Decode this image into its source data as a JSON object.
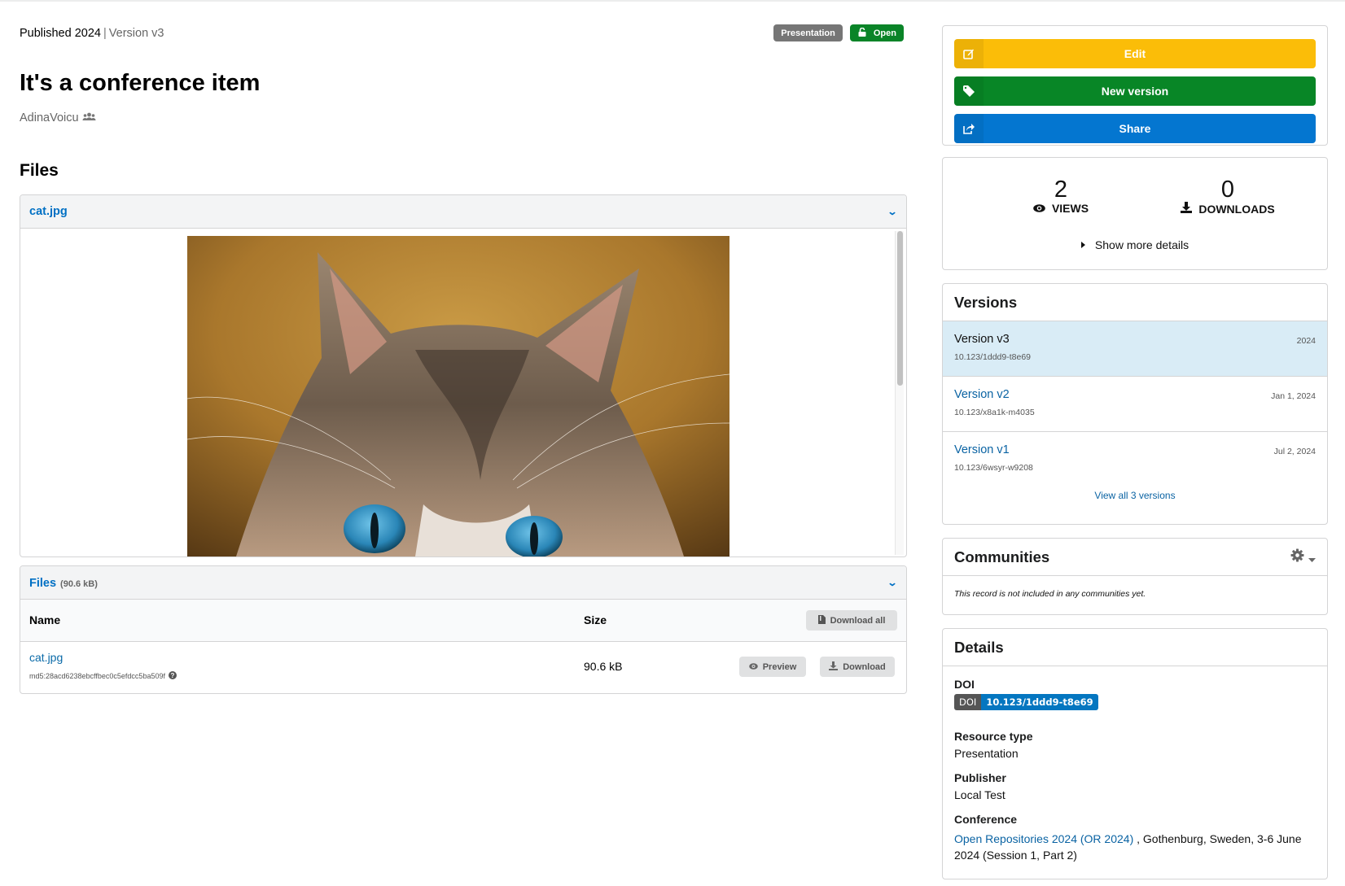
{
  "record": {
    "published": "Published 2024",
    "separator": "|",
    "version": "Version v3",
    "title": "It's a conference item",
    "author": "AdinaVoicu",
    "badges": {
      "resource_type": "Presentation",
      "access": "Open"
    }
  },
  "files_section": {
    "heading": "Files",
    "preview": {
      "filename": "cat.jpg"
    },
    "list": {
      "title": "Files",
      "total_size": "(90.6 kB)",
      "columns": {
        "name": "Name",
        "size": "Size"
      },
      "download_all_label": "Download all",
      "rows": [
        {
          "name": "cat.jpg",
          "checksum": "md5:28acd6238ebcffbec0c5efdcc5ba509f",
          "size": "90.6 kB",
          "preview_label": "Preview",
          "download_label": "Download"
        }
      ]
    }
  },
  "sidebar": {
    "actions": {
      "edit": "Edit",
      "new_version": "New version",
      "share": "Share"
    },
    "stats": {
      "views_count": "2",
      "views_label": "VIEWS",
      "downloads_count": "0",
      "downloads_label": "DOWNLOADS",
      "more_details": "Show more details"
    },
    "versions": {
      "title": "Versions",
      "items": [
        {
          "label": "Version v3",
          "doi": "10.123/1ddd9-t8e69",
          "date": "2024",
          "active": true
        },
        {
          "label": "Version v2",
          "doi": "10.123/x8a1k-m4035",
          "date": "Jan 1, 2024",
          "active": false
        },
        {
          "label": "Version v1",
          "doi": "10.123/6wsyr-w9208",
          "date": "Jul 2, 2024",
          "active": false
        }
      ],
      "view_all": "View all 3 versions"
    },
    "communities": {
      "title": "Communities",
      "empty_text": "This record is not included in any communities yet."
    },
    "details": {
      "title": "Details",
      "doi_label": "DOI",
      "doi_badge_prefix": "DOI",
      "doi_value": "10.123/1ddd9-t8e69",
      "resource_type_label": "Resource type",
      "resource_type": "Presentation",
      "publisher_label": "Publisher",
      "publisher": "Local Test",
      "conference_label": "Conference",
      "conference_link": "Open Repositories 2024 (OR 2024)",
      "conference_rest": " , Gothenburg, Sweden, 3-6 June 2024 (Session 1, Part 2)"
    }
  },
  "colors": {
    "edit": "#fbbd08",
    "new_version": "#088626",
    "share": "#0476d0",
    "link": "#0a63a3",
    "active_version_bg": "#d9ecf6",
    "open_badge": "#0a8428",
    "type_badge": "#767676"
  }
}
